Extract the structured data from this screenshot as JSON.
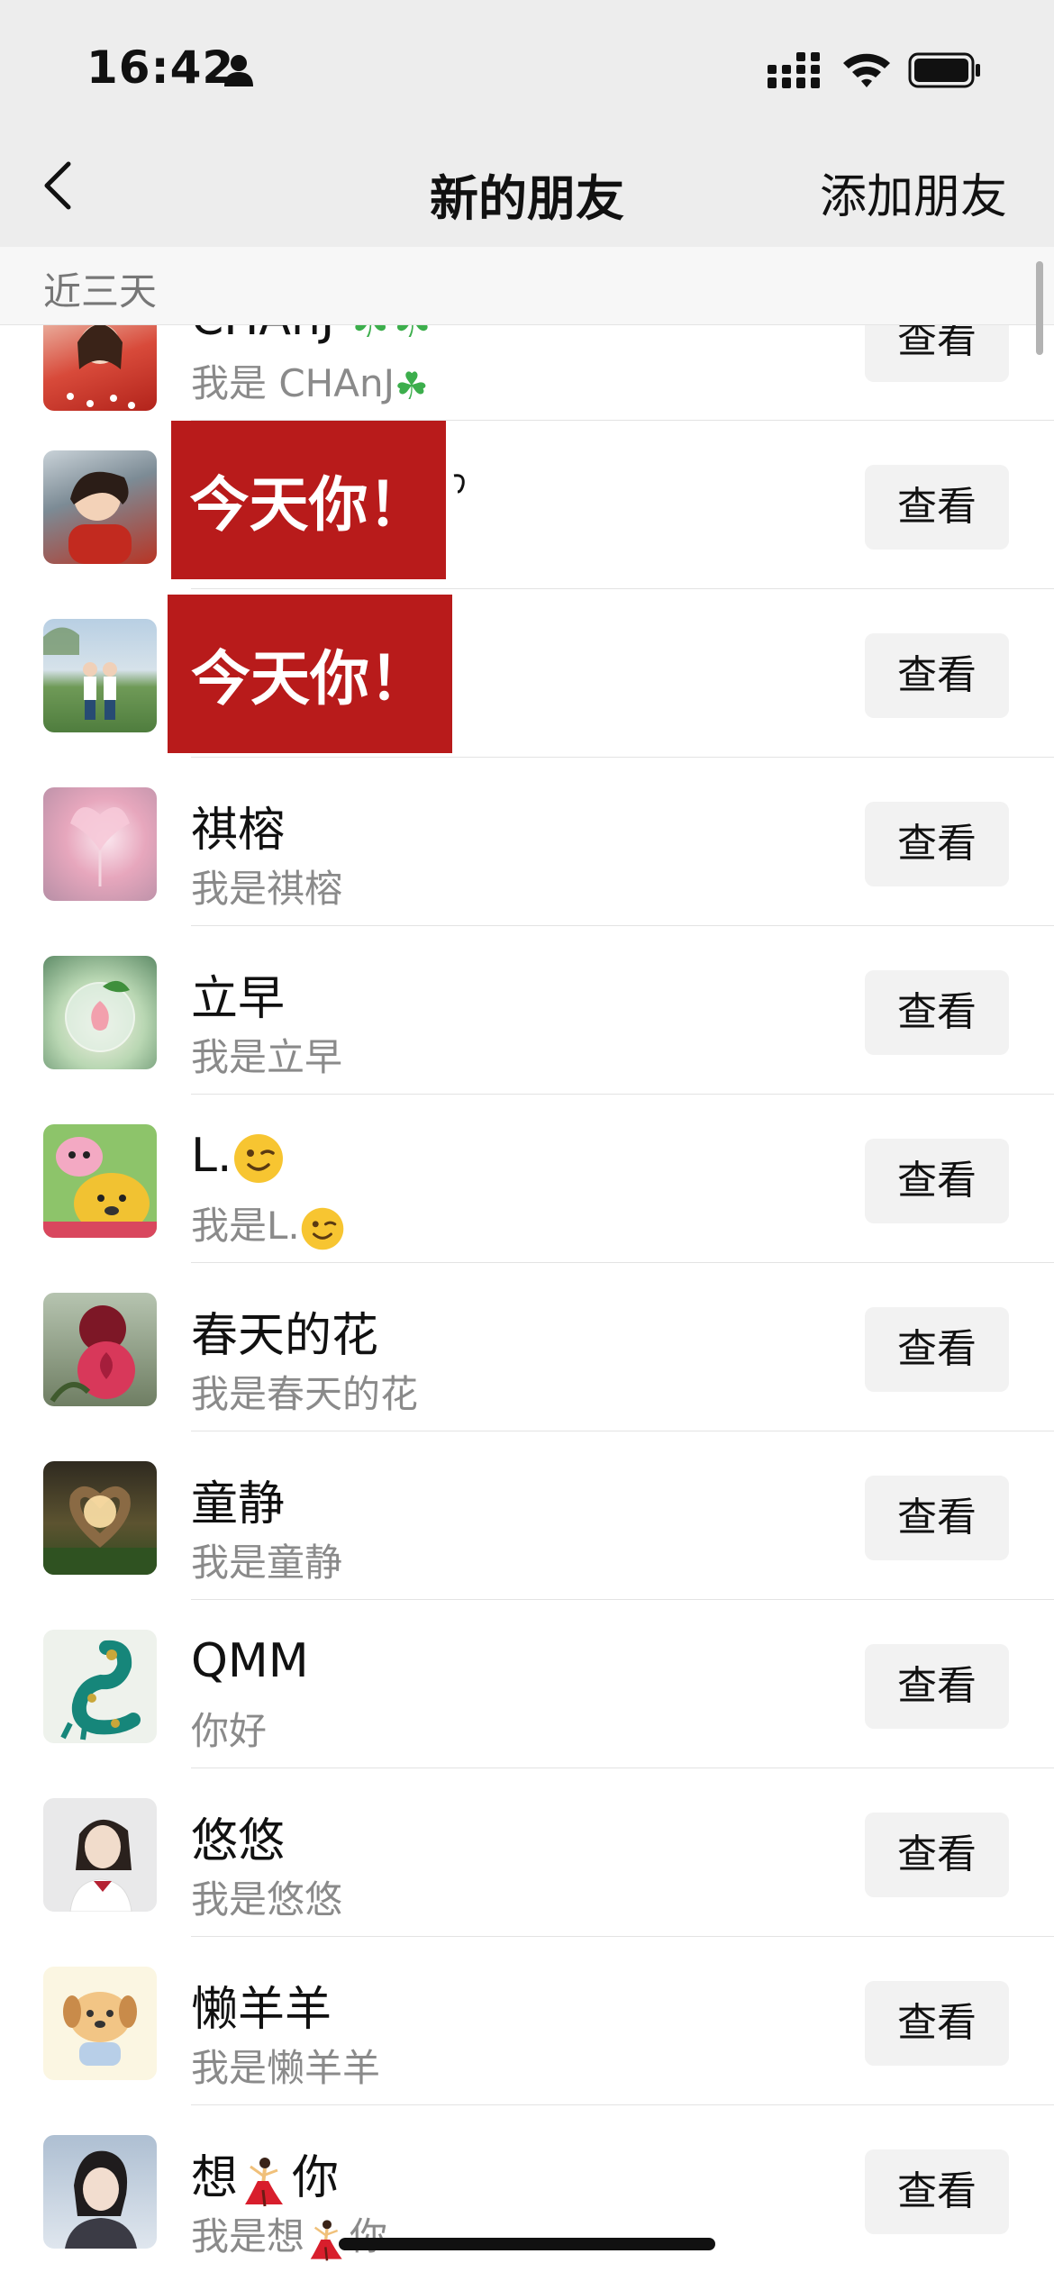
{
  "status_bar": {
    "time": "16:42"
  },
  "nav": {
    "title": "新的朋友",
    "add_label": "添加朋友"
  },
  "section": {
    "label": "近三天"
  },
  "colors": {
    "background": "#ededed",
    "list_bg": "#ffffff",
    "button_bg": "#f2f2f2",
    "banner_red": "#b81b1b",
    "secondary_text": "#8a8a8a"
  },
  "rows": [
    {
      "name": "CHAnJ",
      "message": "我是 CHAnJ",
      "button": "查看"
    },
    {
      "name": "",
      "message": "",
      "button": "查看",
      "overlay": "今天你！"
    },
    {
      "name": "",
      "message": "",
      "button": "查看",
      "overlay": "今天你！"
    },
    {
      "name": "祺榕",
      "message": "我是祺榕",
      "button": "查看"
    },
    {
      "name": "立早",
      "message": "我是立早",
      "button": "查看"
    },
    {
      "name": "L.",
      "message": "我是L.",
      "button": "查看"
    },
    {
      "name": "春天的花",
      "message": "我是春天的花",
      "button": "查看"
    },
    {
      "name": "童静",
      "message": "我是童静",
      "button": "查看"
    },
    {
      "name": "QMM",
      "message": "你好",
      "button": "查看"
    },
    {
      "name": "悠悠",
      "message": "我是悠悠",
      "button": "查看"
    },
    {
      "name": "懒羊羊",
      "message": "我是懒羊羊",
      "button": "查看"
    },
    {
      "name": "想",
      "name_suffix": "你",
      "message": "我是想",
      "message_suffix": "你",
      "button": "查看"
    }
  ],
  "icons": {
    "back": "chevron-left-icon",
    "signal": "cellular-signal-icon",
    "wifi": "wifi-icon",
    "battery": "battery-icon",
    "person": "person-icon",
    "clover": "four-leaf-clover-icon",
    "wink": "winking-face-icon",
    "dancer": "dancer-icon"
  }
}
